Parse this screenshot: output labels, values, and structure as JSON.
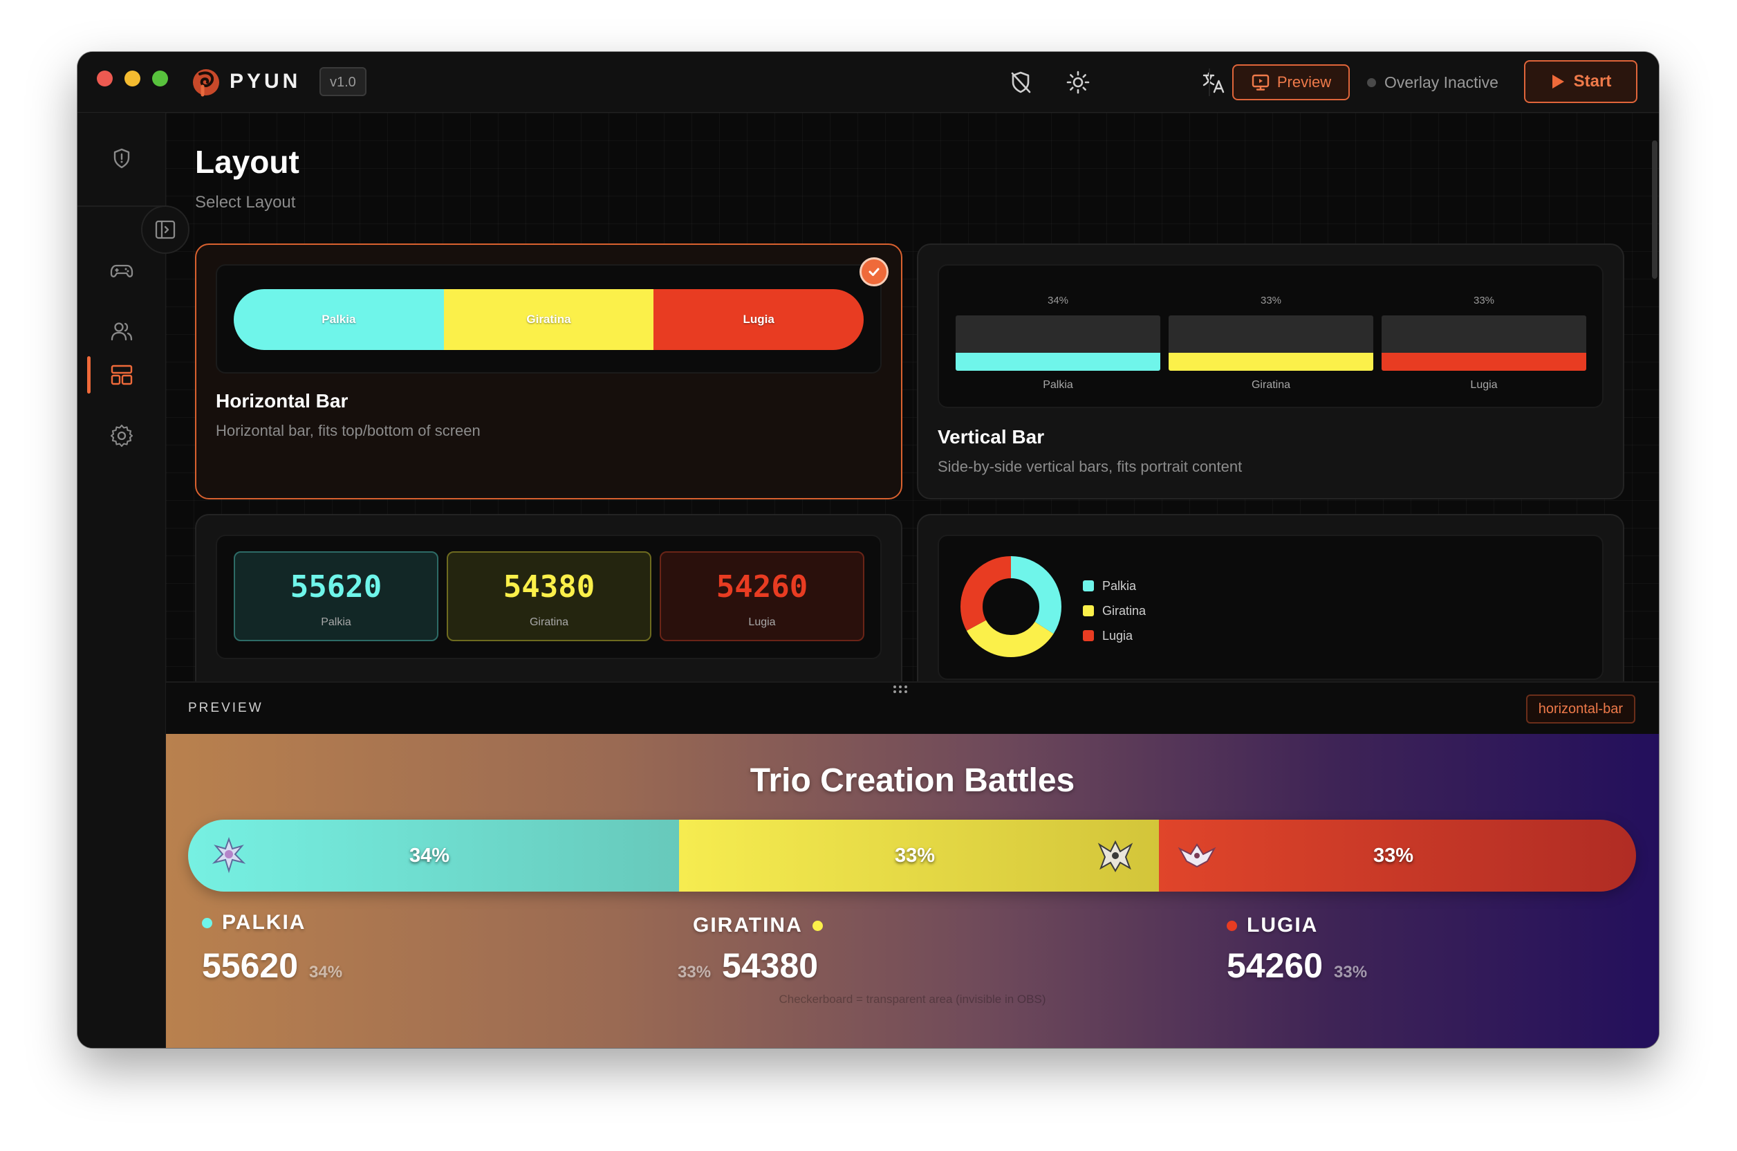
{
  "app": {
    "name": "PYUN",
    "version": "v1.0",
    "lang": "EN",
    "preview_label": "Preview",
    "status": "Overlay Inactive",
    "start_label": "Start"
  },
  "page": {
    "title": "Layout",
    "subtitle": "Select Layout"
  },
  "sidebar": {
    "items": [
      "shield-icon",
      "gamepad-icon",
      "users-icon",
      "layout-icon",
      "gear-icon"
    ],
    "active": "layout-icon"
  },
  "colors": {
    "accent": "#ef6a3a",
    "palkia": "#6ff5ea",
    "giratina": "#fbf04a",
    "lugia": "#e83c22"
  },
  "layouts": {
    "horizontal": {
      "name": "Horizontal Bar",
      "desc": "Horizontal bar, fits top/bottom of screen",
      "labels": [
        "Palkia",
        "Giratina",
        "Lugia"
      ],
      "selected": true
    },
    "vertical": {
      "name": "Vertical Bar",
      "desc": "Side-by-side vertical bars, fits portrait content",
      "pcts": [
        "34%",
        "33%",
        "33%"
      ],
      "labels": [
        "Palkia",
        "Giratina",
        "Lugia"
      ]
    },
    "numbers": {
      "values": [
        "55620",
        "54380",
        "54260"
      ],
      "labels": [
        "Palkia",
        "Giratina",
        "Lugia"
      ]
    },
    "donut": {
      "labels": [
        "Palkia",
        "Giratina",
        "Lugia"
      ],
      "shares": [
        34,
        33,
        33
      ]
    }
  },
  "preview": {
    "header": "PREVIEW",
    "layout_tag": "horizontal-bar",
    "title": "Trio Creation Battles",
    "bar_pcts": [
      "34%",
      "33%",
      "33%"
    ],
    "teams": [
      {
        "name": "PALKIA",
        "score": "55620",
        "pct": "34%"
      },
      {
        "name": "GIRATINA",
        "score": "54380",
        "pct": "33%"
      },
      {
        "name": "LUGIA",
        "score": "54260",
        "pct": "33%"
      }
    ],
    "hint": "Checkerboard = transparent area (invisible in OBS)"
  }
}
